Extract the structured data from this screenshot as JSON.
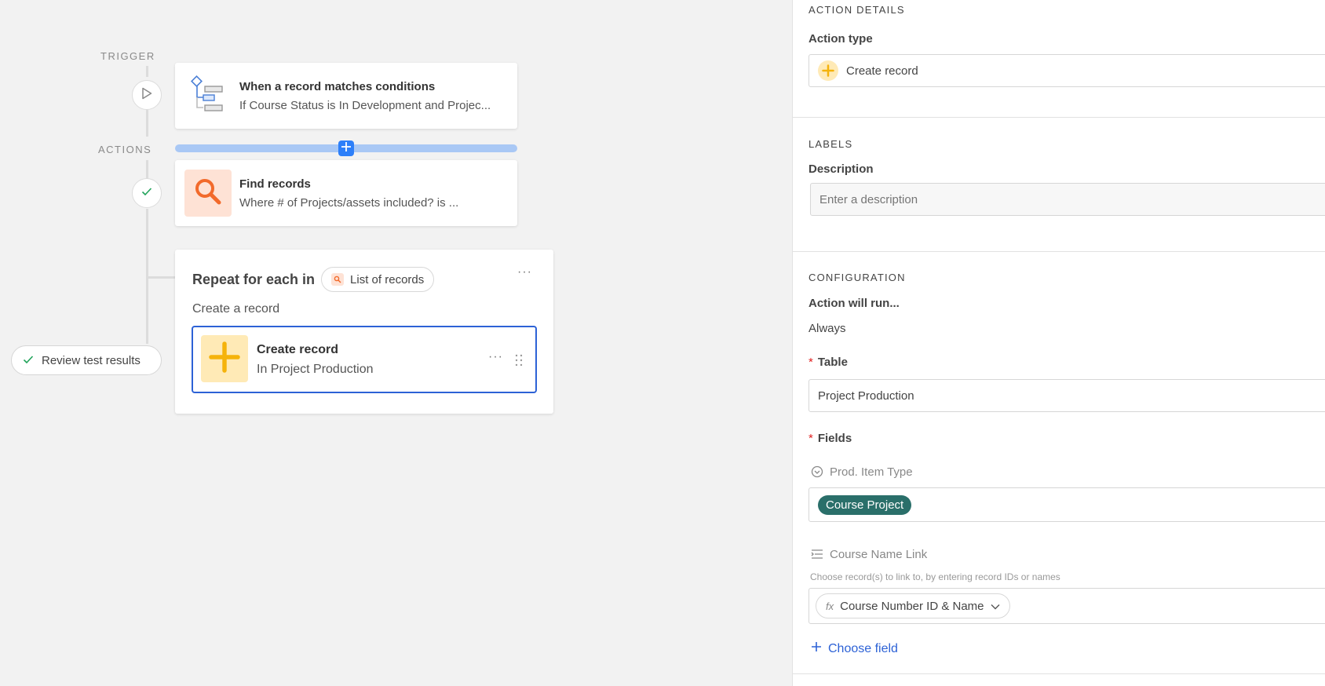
{
  "canvas": {
    "trigger_label": "TRIGGER",
    "actions_label": "ACTIONS",
    "trigger_card": {
      "title": "When a record matches conditions",
      "subtitle": "If Course Status is In Development and Projec..."
    },
    "find_card": {
      "title": "Find records",
      "subtitle": "Where # of Projects/assets included? is ..."
    },
    "repeat_card": {
      "title": "Repeat for each in",
      "list_pill": "List of records",
      "more": "···",
      "subtitle": "Create a record",
      "nested": {
        "title": "Create record",
        "subtitle": "In Project Production",
        "more": "···"
      }
    },
    "review_button": "Review test results"
  },
  "panel": {
    "action_details": {
      "heading": "ACTION DETAILS",
      "action_type_label": "Action type",
      "action_type_value": "Create record"
    },
    "labels": {
      "heading": "LABELS",
      "description_label": "Description",
      "description_placeholder": "Enter a description"
    },
    "configuration": {
      "heading": "CONFIGURATION",
      "run_label": "Action will run...",
      "run_value": "Always",
      "table_label": "Table",
      "table_value": "Project Production",
      "fields_label": "Fields",
      "field1_name": "Prod. Item Type",
      "field1_chip": "Course Project",
      "field2_name": "Course Name Link",
      "field2_hint": "Choose record(s) to link to, by entering record IDs or names",
      "field2_token": "Course Number ID & Name",
      "choose_field": "Choose field"
    }
  },
  "colors": {
    "accent_blue": "#2d7ff9",
    "link_blue": "#2d62d6",
    "chip_teal": "#2a6f6a",
    "create_yellow_bg": "#ffeab6",
    "create_yellow": "#f5b30b",
    "find_orange_bg": "#fee2d5",
    "find_orange": "#f26a2b",
    "success_green": "#20a35a",
    "required_red": "#e02020"
  }
}
